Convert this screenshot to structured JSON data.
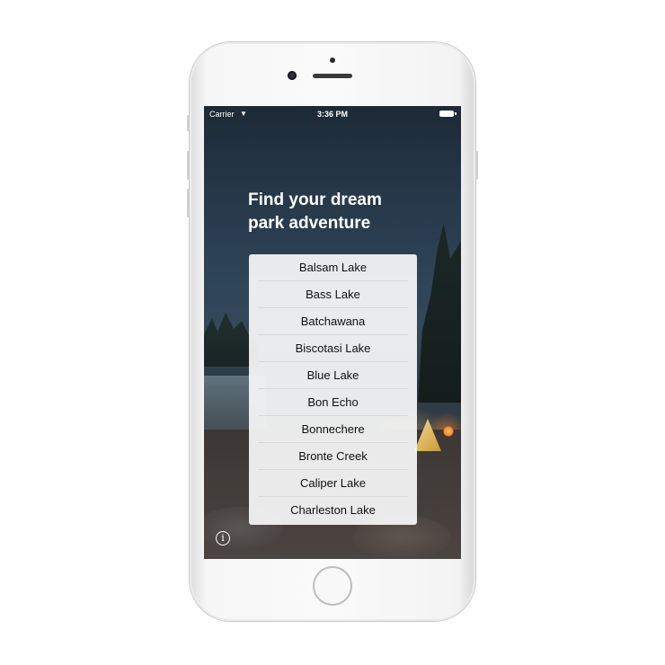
{
  "status_bar": {
    "carrier": "Carrier",
    "time": "3:36 PM"
  },
  "headline": {
    "line1": "Find your dream",
    "line2": "park adventure"
  },
  "park_list": {
    "items": [
      "Balsam Lake",
      "Bass Lake",
      "Batchawana",
      "Biscotasi Lake",
      "Blue Lake",
      "Bon Echo",
      "Bonnechere",
      "Bronte Creek",
      "Caliper Lake",
      "Charleston Lake"
    ]
  },
  "icons": {
    "wifi": "wifi-icon",
    "battery": "battery-icon",
    "info": "info-icon"
  },
  "colors": {
    "text_on_photo": "#ffffff",
    "list_background": "#f8f8f8",
    "list_text": "#111111"
  }
}
